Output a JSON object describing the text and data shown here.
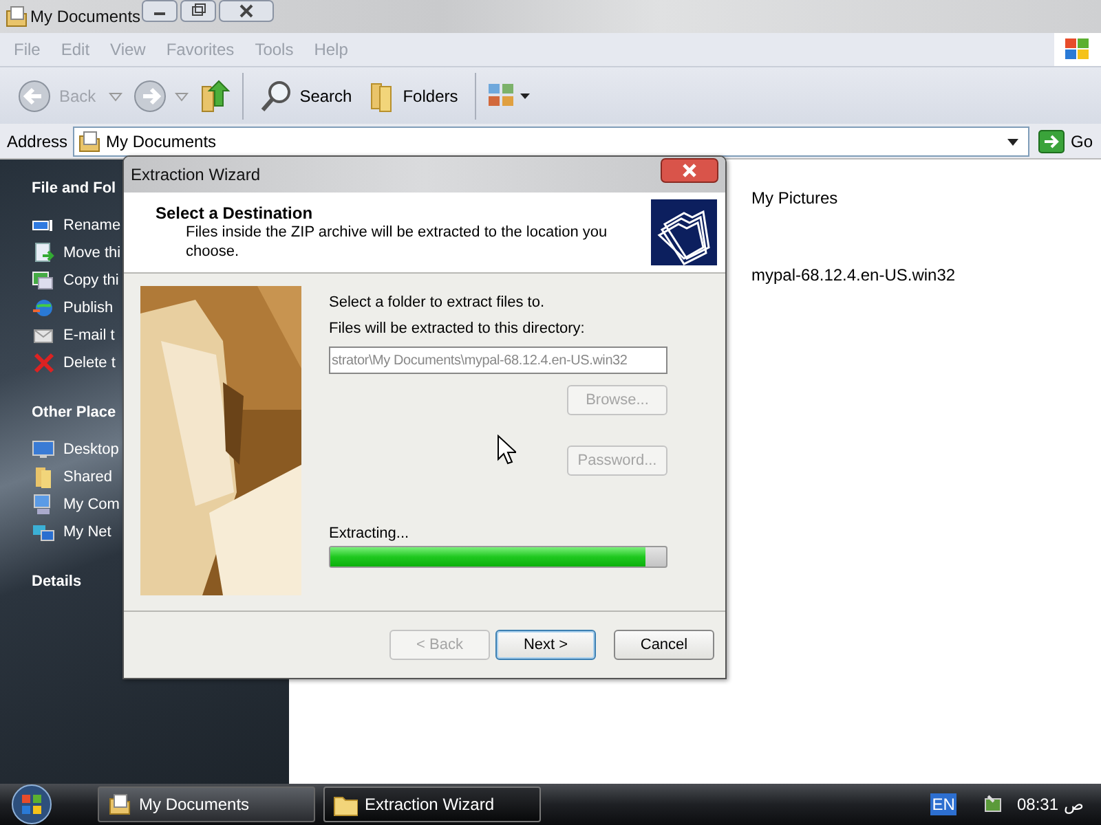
{
  "window": {
    "title": "My Documents"
  },
  "menu": [
    "File",
    "Edit",
    "View",
    "Favorites",
    "Tools",
    "Help"
  ],
  "toolbar": {
    "back": {
      "label": "Back",
      "disabled": true
    },
    "search": "Search",
    "folders": "Folders"
  },
  "address": {
    "label": "Address",
    "value": "My Documents",
    "go": "Go"
  },
  "sidebar": [
    {
      "title": "File and Fol",
      "items": [
        "Rename",
        "Move thi",
        "Copy thi",
        "Publish",
        "E-mail t",
        "Delete t"
      ]
    },
    {
      "title": "Other Place",
      "items": [
        "Desktop",
        "Shared",
        "My Com",
        "My Net"
      ]
    },
    {
      "title": "Details"
    }
  ],
  "content": [
    "My Pictures",
    "mypal-68.12.4.en-US.win32"
  ],
  "dialog": {
    "title": "Extraction Wizard",
    "heading": "Select a Destination",
    "subtitle": "Files inside the ZIP archive will be extracted to the location you choose.",
    "prompt": "Select a folder to extract files to.",
    "field_label": "Files will be extracted to this directory:",
    "path": "strator\\My Documents\\mypal-68.12.4.en-US.win32",
    "side_buttons": [
      {
        "label": "Browse...",
        "disabled": true
      },
      {
        "label": "Password...",
        "disabled": true
      }
    ],
    "progress": {
      "label": "Extracting...",
      "level": 0.94
    },
    "buttons": [
      {
        "label": "< Back",
        "disabled": true,
        "default": false
      },
      {
        "label": "Next >",
        "disabled": false,
        "default": true
      },
      {
        "label": "Cancel",
        "disabled": false,
        "default": false
      }
    ]
  },
  "taskbar": {
    "tasks": [
      {
        "label": "My Documents",
        "selected": false
      },
      {
        "label": "Extraction Wizard",
        "selected": true
      }
    ],
    "language": "EN",
    "time": "08:31",
    "period": "ص"
  }
}
